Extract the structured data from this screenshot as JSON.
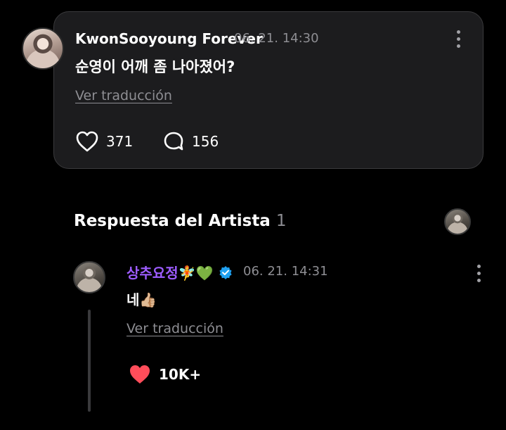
{
  "post": {
    "author": "KwonSooyoung Forever",
    "date": "06. 21. 14:30",
    "text": "순영이 어깨 좀 나아졌어?",
    "translate_link": "Ver traducción",
    "likes": "371",
    "comments": "156"
  },
  "artist_section": {
    "title": "Respuesta del Artista",
    "count": "1"
  },
  "reply": {
    "author": "상추요정🧚💚",
    "date": "06. 21. 14:31",
    "text": "네👍🏼",
    "translate_link": "Ver traducción",
    "likes": "10K+"
  },
  "colors": {
    "background": "#000000",
    "card": "#1c1c1e",
    "artist_name": "#9d5cff",
    "like_heart": "#ff4d5a",
    "verified": "#1fa1f1"
  },
  "icons": {
    "like": "heart-outline-icon",
    "comment": "speech-bubble-icon",
    "more": "kebab-menu-icon",
    "verified": "verified-badge-icon",
    "liked": "heart-filled-icon"
  }
}
